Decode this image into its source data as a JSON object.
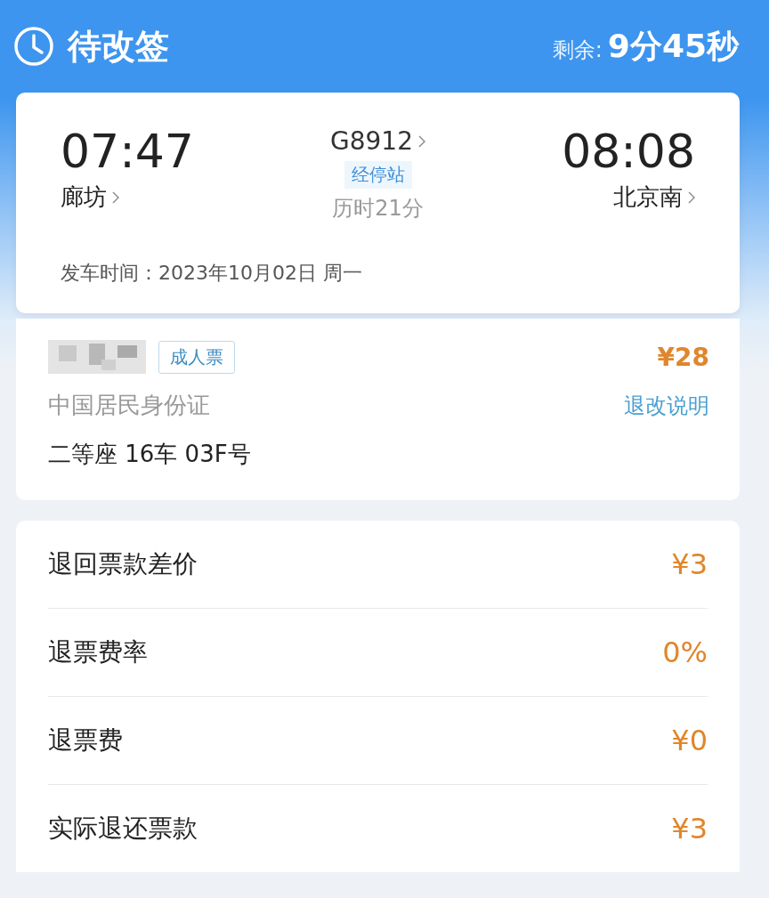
{
  "header": {
    "title": "待改签",
    "remaining_label": "剩余:",
    "remaining_time": "9分45秒"
  },
  "trip": {
    "depart_time": "07:47",
    "depart_station": "廊坊",
    "train_no": "G8912",
    "stops_link": "经停站",
    "duration": "历时21分",
    "arrive_time": "08:08",
    "arrive_station": "北京南",
    "date_line": "发车时间：2023年10月02日 周一"
  },
  "passenger": {
    "ticket_type": "成人票",
    "price": "¥28",
    "id_type": "中国居民身份证",
    "refund_rules": "退改说明",
    "seat": "二等座 16车 03F号"
  },
  "refund_rows": [
    {
      "label": "退回票款差价",
      "value": "¥3"
    },
    {
      "label": "退票费率",
      "value": "0%"
    },
    {
      "label": "退票费",
      "value": "¥0"
    },
    {
      "label": "实际退还票款",
      "value": "¥3"
    }
  ]
}
